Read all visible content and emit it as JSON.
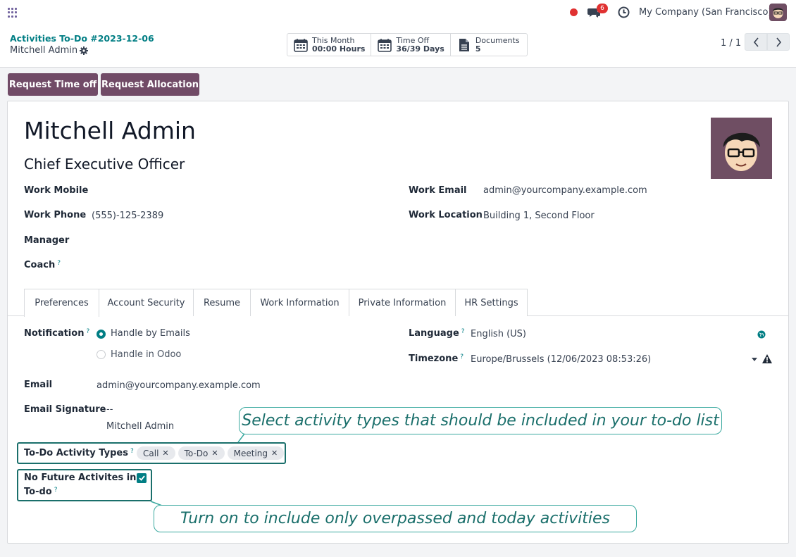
{
  "topbar": {
    "chat_badge": "6",
    "company": "My Company (San Francisco)"
  },
  "breadcrumb": {
    "parent": "Activities To-Do #2023-12-06",
    "current": "Mitchell Admin"
  },
  "smart_buttons": [
    {
      "title": "This Month",
      "value": "00:00 Hours",
      "icon": "calendar-icon"
    },
    {
      "title": "Time Off",
      "value": "36/39 Days",
      "icon": "calendar-icon"
    },
    {
      "title": "Documents",
      "value": "5",
      "icon": "document-icon"
    }
  ],
  "pager": {
    "text": "1 / 1"
  },
  "actions": {
    "request_time_off": "Request Time off",
    "request_allocation": "Request Allocation"
  },
  "employee": {
    "name": "Mitchell Admin",
    "job_title": "Chief Executive Officer",
    "work_mobile_label": "Work Mobile",
    "work_mobile": "",
    "work_phone_label": "Work Phone",
    "work_phone": "(555)-125-2389",
    "manager_label": "Manager",
    "coach_label": "Coach",
    "work_email_label": "Work Email",
    "work_email": "admin@yourcompany.example.com",
    "work_location_label": "Work Location",
    "work_location": "Building 1, Second Floor"
  },
  "tabs": [
    "Preferences",
    "Account Security",
    "Resume",
    "Work Information",
    "Private Information",
    "HR Settings"
  ],
  "preferences": {
    "notification_label": "Notification",
    "notification_options": [
      "Handle by Emails",
      "Handle in Odoo"
    ],
    "language_label": "Language",
    "language": "English (US)",
    "timezone_label": "Timezone",
    "timezone": "Europe/Brussels (12/06/2023 08:53:26)",
    "email_label": "Email",
    "email": "admin@yourcompany.example.com",
    "signature_label": "Email Signature",
    "signature_dashes": "--",
    "signature_name": "Mitchell Admin",
    "todo_types_label": "To-Do Activity Types",
    "todo_types": [
      "Call",
      "To-Do",
      "Meeting"
    ],
    "no_future_label_1": "No Future Activites in",
    "no_future_label_2": "To-do",
    "help_mark": "?"
  },
  "callouts": {
    "types": "Select activity types that should be included in your to-do list",
    "future": "Turn on to include only overpassed and today activities"
  },
  "colors": {
    "brand": "#714b67",
    "accent": "#017e84",
    "callout": "#1a6f6b"
  }
}
